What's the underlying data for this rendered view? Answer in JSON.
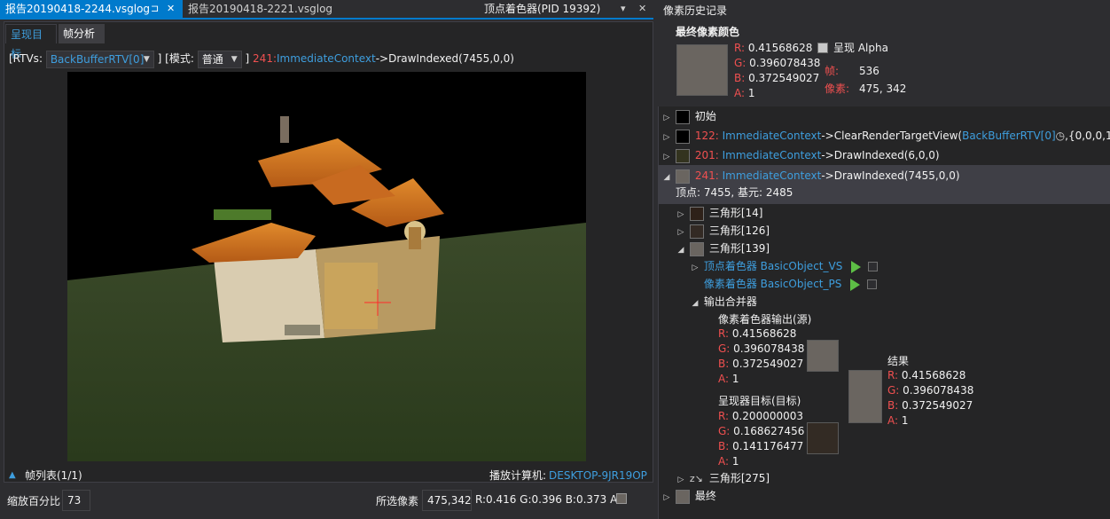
{
  "doc_tabs": {
    "active": "报告20190418-2244.vsglog",
    "active_pin": "⊐",
    "active_close": "✕",
    "inactive": "报告20190418-2221.vsglog",
    "right_title": "顶点着色器(PID 19392)",
    "right_dropdown": "▾",
    "right_close": "✕"
  },
  "sub_tabs": {
    "render_target": "呈现目标",
    "frame_analysis": "帧分析"
  },
  "toolbar": {
    "rtvs_prefix": "[RTVs:",
    "rtv_value": "BackBufferRTV[0]",
    "mode_prefix": "] [模式:",
    "mode_value": "普通",
    "suffix": "]",
    "event_id": "241:",
    "event_obj": "ImmediateContext",
    "event_call": "->DrawIndexed(7455,0,0)"
  },
  "frame_list": {
    "label": "帧列表(1/1)",
    "machine_label": "播放计算机:",
    "machine_value": "DESKTOP-9JR19OP"
  },
  "status": {
    "zoom_label": "缩放百分比",
    "zoom_value": "73",
    "selected_label": "所选像素",
    "selected_value": "475,342",
    "rgba_text": "R:0.416 G:0.396 B:0.373 A:1"
  },
  "history": {
    "title": "像素历史记录",
    "final_title": "最终像素颜色",
    "final": {
      "r": "0.41568628",
      "g": "0.396078438",
      "b": "0.372549027",
      "a": "1"
    },
    "show_alpha": "呈现 Alpha",
    "frame_label": "帧:",
    "frame_value": "536",
    "pixel_label": "像素:",
    "pixel_value": "475, 342",
    "initial": "初始",
    "ev122_id": "122:",
    "ev122_obj": "ImmediateContext",
    "ev122_call": "->ClearRenderTargetView(",
    "ev122_arg": "BackBufferRTV[0]",
    "ev122_tail": ",{0,0,0,1})",
    "ev201_id": "201:",
    "ev201_obj": "ImmediateContext",
    "ev201_call": "->DrawIndexed(6,0,0)",
    "ev241_id": "241:",
    "ev241_obj": "ImmediateContext",
    "ev241_call": "->DrawIndexed(7455,0,0)",
    "ev241_detail": "顶点: 7455, 基元: 2485",
    "tri14": "三角形[14]",
    "tri126": "三角形[126]",
    "tri139": "三角形[139]",
    "vs_label": "顶点着色器 BasicObject_VS",
    "ps_label": "像素着色器 BasicObject_PS",
    "om_label": "输出合并器",
    "ps_out_title": "像素着色器输出(源)",
    "ps_out": {
      "r": "0.41568628",
      "g": "0.396078438",
      "b": "0.372549027",
      "a": "1"
    },
    "rt_title": "呈现器目标(目标)",
    "rt": {
      "r": "0.200000003",
      "g": "0.168627456",
      "b": "0.141176477",
      "a": "1"
    },
    "result_title": "结果",
    "result": {
      "r": "0.41568628",
      "g": "0.396078438",
      "b": "0.372549027",
      "a": "1"
    },
    "tri275": "三角形[275]",
    "final_item": "最终",
    "r_lbl": "R:",
    "g_lbl": "G:",
    "b_lbl": "B:",
    "a_lbl": "A:"
  },
  "colors": {
    "accent": "#007acc",
    "final_pixel": "#6a6560",
    "initial": "#000000",
    "ev122": "#000000",
    "ev201": "#33331f",
    "ev241": "#6a6560",
    "tri14": "#2e2119",
    "tri126": "#332a24",
    "tri139": "#6a6560",
    "rt_color": "#332b24"
  }
}
